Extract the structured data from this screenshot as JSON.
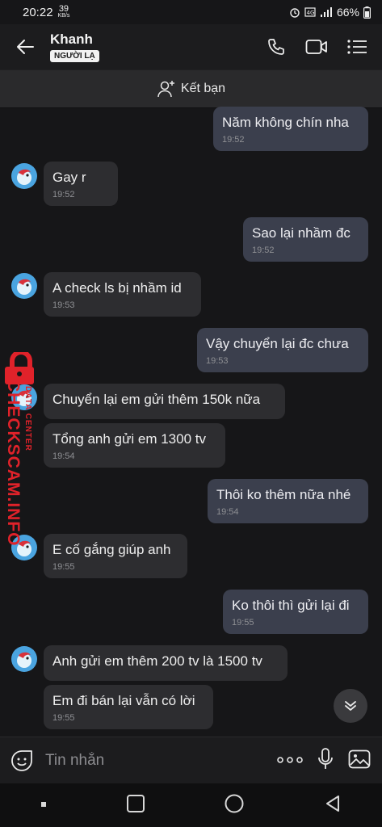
{
  "status_bar": {
    "time": "20:22",
    "net_speed": "39",
    "net_unit": "KB/s",
    "battery": "66%"
  },
  "header": {
    "contact_name": "Khanh",
    "badge": "NGƯỜI LẠ"
  },
  "friend_bar": {
    "label": "Kết bạn"
  },
  "messages": [
    {
      "dir": "out",
      "text": "Năm không chín nha",
      "time": "19:52"
    },
    {
      "dir": "in",
      "text": "Gay r",
      "time": "19:52"
    },
    {
      "dir": "out",
      "text": "Sao lại nhầm đc",
      "time": "19:52"
    },
    {
      "dir": "in",
      "text": "A check ls bị nhầm id",
      "time": "19:53"
    },
    {
      "dir": "out",
      "text": "Vậy chuyển lại đc chưa",
      "time": "19:53"
    },
    {
      "dir": "in",
      "text": "Chuyển lại em gửi thêm 150k nữa",
      "time": ""
    },
    {
      "dir": "in",
      "text": "Tổng anh gửi em 1300 tv",
      "time": "19:54"
    },
    {
      "dir": "out",
      "text": "Thôi ko thêm nữa nhé",
      "time": "19:54"
    },
    {
      "dir": "in",
      "text": "E cố gắng giúp anh",
      "time": "19:55"
    },
    {
      "dir": "out",
      "text": "Ko thôi thì gửi lại đi",
      "time": "19:55"
    },
    {
      "dir": "in",
      "text": "Anh gửi em thêm 200 tv là 1500 tv",
      "time": ""
    },
    {
      "dir": "in",
      "text": "Em đi bán lại vẫn có lời",
      "time": "19:55"
    }
  ],
  "watermark": {
    "main": "CHECKSCAM.INFO",
    "sub": "DATA CENTER"
  },
  "input": {
    "placeholder": "Tin nhắn"
  },
  "colors": {
    "outgoing_bubble": "#3b3f4d",
    "incoming_bubble": "#2d2d30",
    "watermark": "#e0222a"
  }
}
